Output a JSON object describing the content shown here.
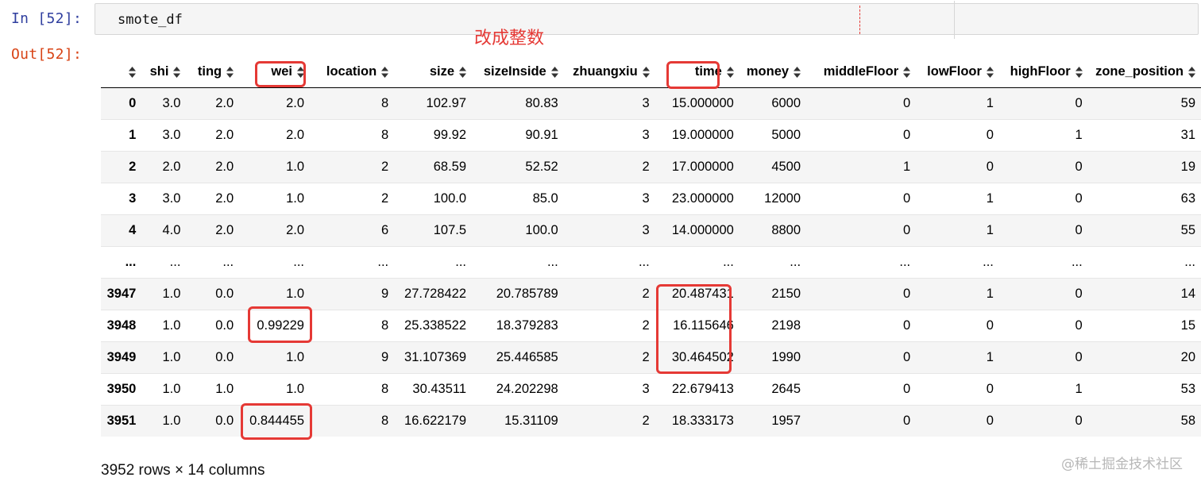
{
  "input_prompt": "In [52]:",
  "output_prompt": "Out[52]:",
  "code": "smote_df",
  "annotation": "改成整数",
  "columns": [
    "",
    "shi",
    "ting",
    "wei",
    "location",
    "size",
    "sizeInside",
    "zhuangxiu",
    "time",
    "money",
    "middleFloor",
    "lowFloor",
    "highFloor",
    "zone_position"
  ],
  "rows": [
    [
      "0",
      "3.0",
      "2.0",
      "2.0",
      "8",
      "102.97",
      "80.83",
      "3",
      "15.000000",
      "6000",
      "0",
      "1",
      "0",
      "59"
    ],
    [
      "1",
      "3.0",
      "2.0",
      "2.0",
      "8",
      "99.92",
      "90.91",
      "3",
      "19.000000",
      "5000",
      "0",
      "0",
      "1",
      "31"
    ],
    [
      "2",
      "2.0",
      "2.0",
      "1.0",
      "2",
      "68.59",
      "52.52",
      "2",
      "17.000000",
      "4500",
      "1",
      "0",
      "0",
      "19"
    ],
    [
      "3",
      "3.0",
      "2.0",
      "1.0",
      "2",
      "100.0",
      "85.0",
      "3",
      "23.000000",
      "12000",
      "0",
      "1",
      "0",
      "63"
    ],
    [
      "4",
      "4.0",
      "2.0",
      "2.0",
      "6",
      "107.5",
      "100.0",
      "3",
      "14.000000",
      "8800",
      "0",
      "1",
      "0",
      "55"
    ],
    [
      "...",
      "...",
      "...",
      "...",
      "...",
      "...",
      "...",
      "...",
      "...",
      "...",
      "...",
      "...",
      "...",
      "..."
    ],
    [
      "3947",
      "1.0",
      "0.0",
      "1.0",
      "9",
      "27.728422",
      "20.785789",
      "2",
      "20.487431",
      "2150",
      "0",
      "1",
      "0",
      "14"
    ],
    [
      "3948",
      "1.0",
      "0.0",
      "0.99229",
      "8",
      "25.338522",
      "18.379283",
      "2",
      "16.115646",
      "2198",
      "0",
      "0",
      "0",
      "15"
    ],
    [
      "3949",
      "1.0",
      "0.0",
      "1.0",
      "9",
      "31.107369",
      "25.446585",
      "2",
      "30.464502",
      "1990",
      "0",
      "1",
      "0",
      "20"
    ],
    [
      "3950",
      "1.0",
      "1.0",
      "1.0",
      "8",
      "30.43511",
      "24.202298",
      "3",
      "22.679413",
      "2645",
      "0",
      "0",
      "1",
      "53"
    ],
    [
      "3951",
      "1.0",
      "0.0",
      "0.844455",
      "8",
      "16.622179",
      "15.31109",
      "2",
      "18.333173",
      "1957",
      "0",
      "0",
      "0",
      "58"
    ]
  ],
  "row_count_text": "3952 rows × 14 columns",
  "watermark": "@稀土掘金技术社区",
  "highlight_color": "#e53935",
  "icons": {
    "sort": "sort-icon"
  }
}
